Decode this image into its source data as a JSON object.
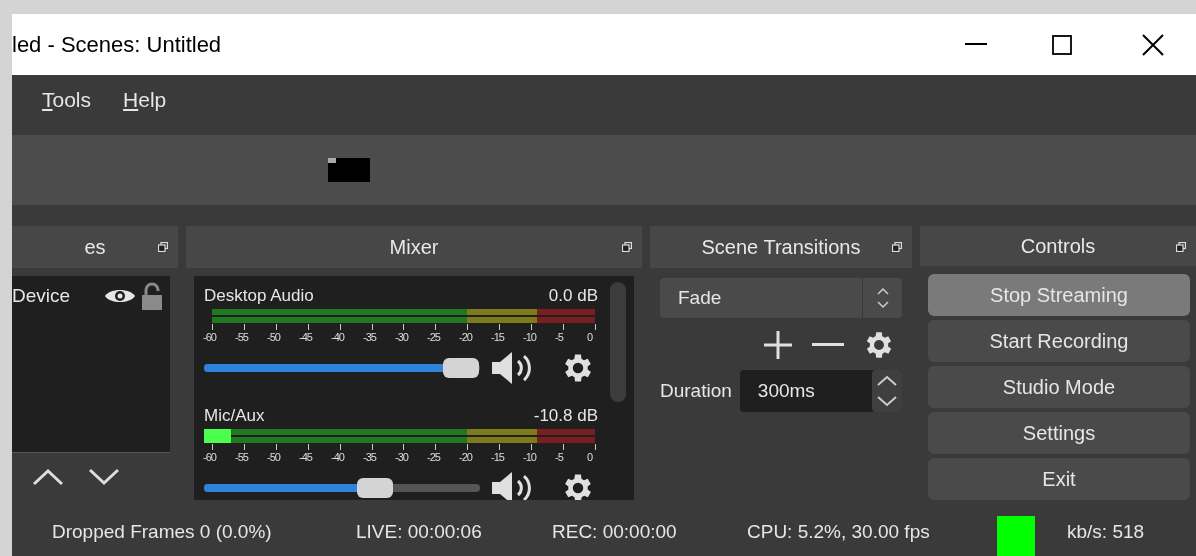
{
  "window": {
    "title": "led - Scenes: Untitled"
  },
  "menu": [
    {
      "label": "Tools"
    },
    {
      "label": "Help"
    }
  ],
  "docks": {
    "sources": {
      "title": "es",
      "items": [
        {
          "label": "Device",
          "visible": true,
          "locked": false
        }
      ]
    },
    "mixer": {
      "title": "Mixer",
      "channels": [
        {
          "name": "Desktop Audio",
          "reading": "0.0 dB",
          "scale": [
            "-60",
            "-55",
            "-50",
            "-45",
            "-40",
            "-35",
            "-30",
            "-25",
            "-20",
            "-15",
            "-10",
            "-5",
            "0"
          ],
          "volume": {
            "level": 0.93
          }
        },
        {
          "name": "Mic/Aux",
          "reading": "-10.8 dB",
          "meter": {
            "level": 0.07
          },
          "scale": [
            "-60",
            "-55",
            "-50",
            "-45",
            "-40",
            "-35",
            "-30",
            "-25",
            "-20",
            "-15",
            "-10",
            "-5",
            "0"
          ],
          "volume": {
            "level": 0.62
          }
        }
      ]
    },
    "transitions": {
      "title": "Scene Transitions",
      "transition": "Fade",
      "duration_label": "Duration",
      "duration": "300ms"
    },
    "controls": {
      "title": "Controls",
      "buttons": [
        {
          "label": "Stop Streaming",
          "selected": true
        },
        {
          "label": "Start Recording",
          "selected": false
        },
        {
          "label": "Studio Mode",
          "selected": false
        },
        {
          "label": "Settings",
          "selected": false
        },
        {
          "label": "Exit",
          "selected": false
        }
      ]
    }
  },
  "status_bar": {
    "dropped": "Dropped Frames 0 (0.0%)",
    "live": "LIVE: 00:00:06",
    "rec": "REC: 00:00:00",
    "cpu": "CPU: 5.2%, 30.00 fps",
    "connection_ok": true,
    "bitrate": "kb/s: 518"
  }
}
